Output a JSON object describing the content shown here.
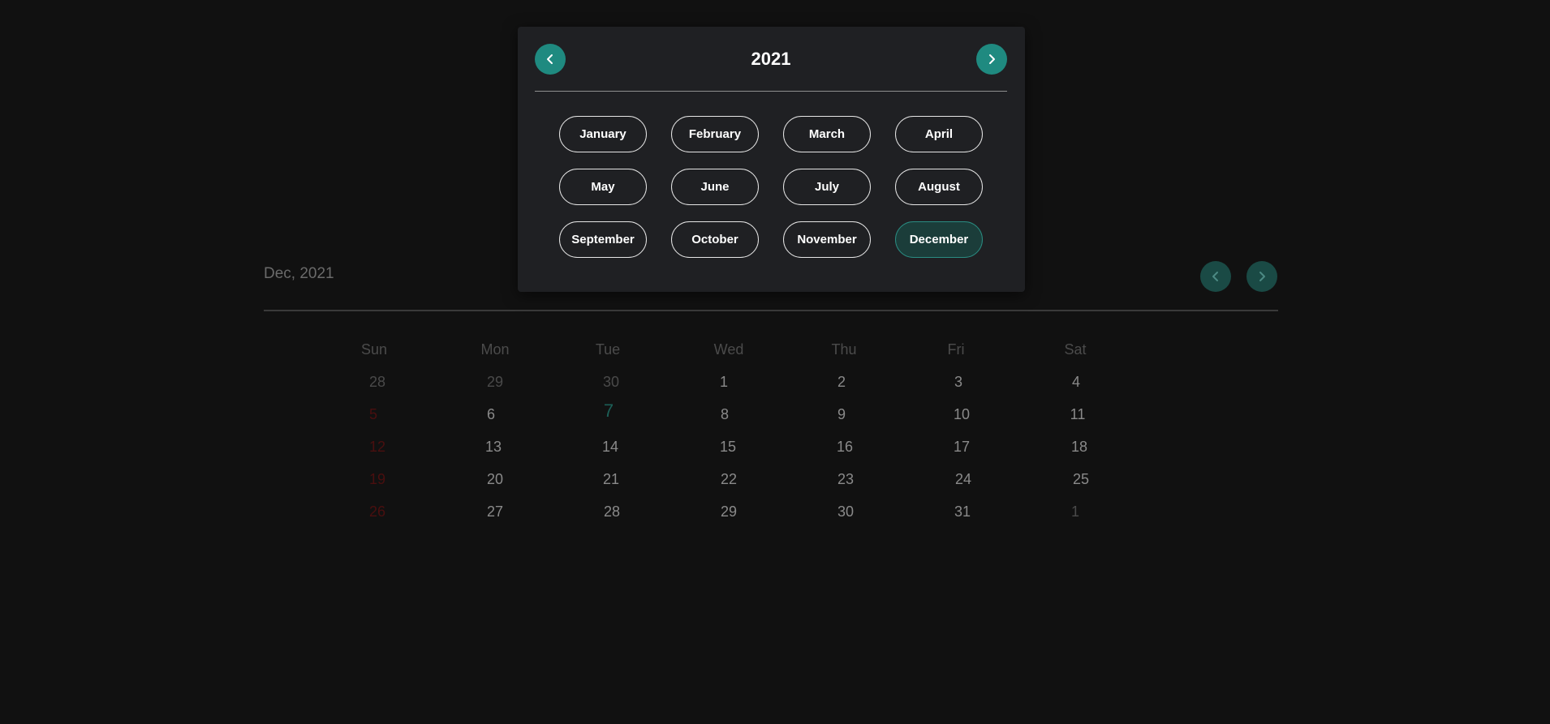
{
  "calendar": {
    "title": "Dec, 2021",
    "prev_icon": "chevron-left-icon",
    "next_icon": "chevron-right-icon",
    "weekdays": [
      "Sun",
      "Mon",
      "Tue",
      "Wed",
      "Thu",
      "Fri",
      "Sat"
    ],
    "weeks": [
      [
        "28",
        "29",
        "30",
        "1",
        "2",
        "3",
        "4"
      ],
      [
        "5",
        "6",
        "7",
        "8",
        "9",
        "10",
        "11"
      ],
      [
        "12",
        "13",
        "14",
        "15",
        "16",
        "17",
        "18"
      ],
      [
        "19",
        "20",
        "21",
        "22",
        "23",
        "24",
        "25"
      ],
      [
        "26",
        "27",
        "28",
        "29",
        "30",
        "31",
        "1"
      ]
    ]
  },
  "picker": {
    "year": "2021",
    "prev_icon": "chevron-left-icon",
    "next_icon": "chevron-right-icon",
    "months": [
      "January",
      "February",
      "March",
      "April",
      "May",
      "June",
      "July",
      "August",
      "September",
      "October",
      "November",
      "December"
    ],
    "selected_month": "December"
  },
  "colors": {
    "background": "#111111",
    "accent": "#1f8a80",
    "selected_month_bg": "#1b3d3a",
    "sunday": "#4a0f0f"
  }
}
